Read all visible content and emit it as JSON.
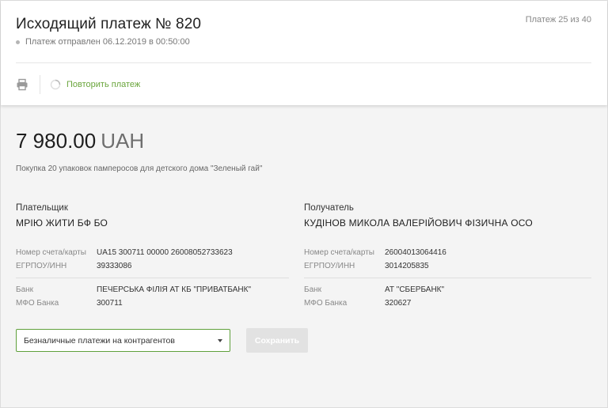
{
  "header": {
    "title": "Исходящий платеж № 820",
    "status": "Платеж отправлен 06.12.2019 в 00:50:00",
    "counter": "Платеж 25 из 40"
  },
  "toolbar": {
    "print_icon": "printer-icon",
    "repeat_icon": "refresh-icon",
    "repeat_label": "Повторить платеж"
  },
  "payment": {
    "amount": "7 980.00",
    "currency": "UAH",
    "purpose": "Покупка 20 упаковок памперосов для детского дома \"Зеленый гай\""
  },
  "payer": {
    "label": "Плательщик",
    "name": "МРІЮ ЖИТИ БФ БО",
    "account_label": "Номер счета/карты",
    "account": "UA15 300711 00000 26008052733623",
    "edrpou_label": "ЕГРПОУ/ИНН",
    "edrpou": "39333086",
    "bank_label": "Банк",
    "bank": "ПЕЧЕРСЬКА ФІЛІЯ АТ КБ \"ПРИВАТБАНК\"",
    "mfo_label": "МФО Банка",
    "mfo": "300711"
  },
  "recipient": {
    "label": "Получатель",
    "name": "КУДІНОВ МИКОЛА ВАЛЕРІЙОВИЧ ФІЗИЧНА ОСО",
    "account_label": "Номер счета/карты",
    "account": "26004013064416",
    "edrpou_label": "ЕГРПОУ/ИНН",
    "edrpou": "3014205835",
    "bank_label": "Банк",
    "bank": "АТ \"СБЕРБАНК\"",
    "mfo_label": "МФО Банка",
    "mfo": "320627"
  },
  "footer": {
    "category_selected": "Безналичные платежи на контрагентов",
    "save_label": "Сохранить"
  },
  "colors": {
    "accent": "#6aa53c",
    "select_border": "#5fa03b",
    "disabled_button": "#e2e2e2"
  }
}
